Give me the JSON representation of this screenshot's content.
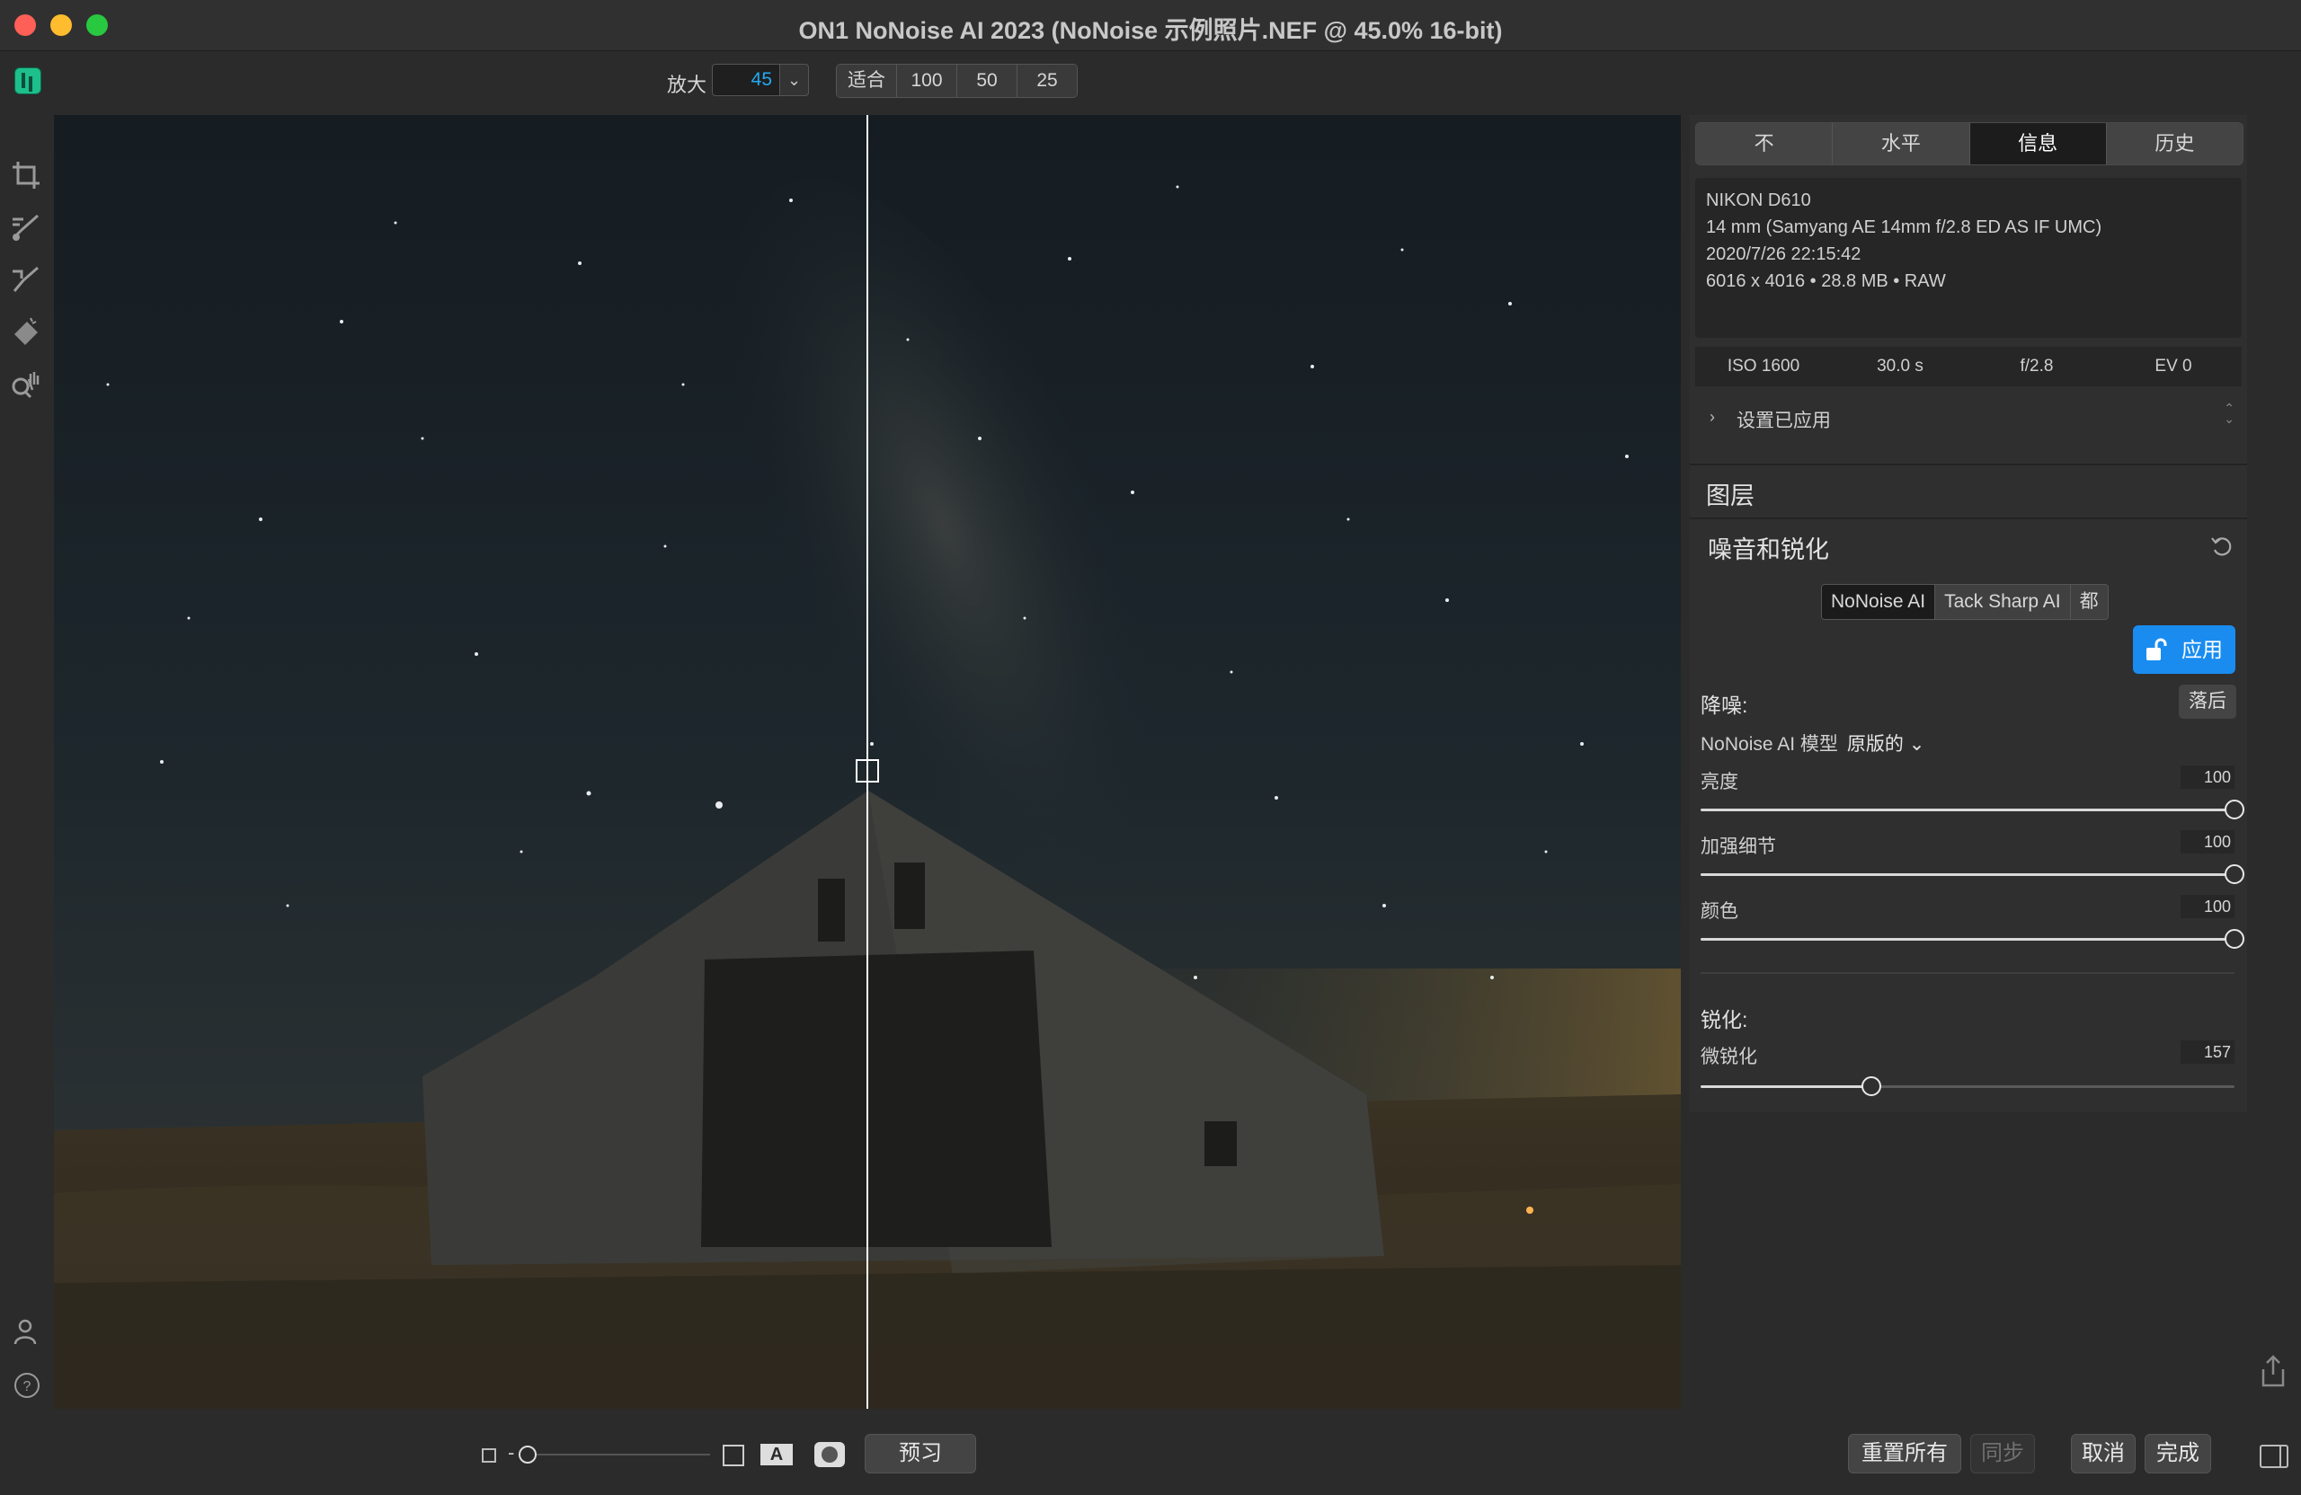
{
  "window": {
    "title": "ON1 NoNoise AI 2023 (NoNoise 示例照片.NEF @ 45.0% 16-bit)"
  },
  "toolbar": {
    "zoom_label": "放大",
    "zoom_value": "45",
    "zoom_presets": [
      "适合",
      "100",
      "50",
      "25"
    ]
  },
  "left_tools": [
    "crop-icon",
    "brush-icon",
    "retouch-brush-icon",
    "eraser-icon",
    "zoom-pan-icon"
  ],
  "panel": {
    "tabs": [
      {
        "label": "不",
        "active": false
      },
      {
        "label": "水平",
        "active": false
      },
      {
        "label": "信息",
        "active": true
      },
      {
        "label": "历史",
        "active": false
      }
    ],
    "info": {
      "camera": "NIKON D610",
      "lens": "14 mm (Samyang AE 14mm f/2.8 ED AS IF UMC)",
      "datetime": "2020/7/26  22:15:42",
      "size": "6016 x 4016 • 28.8 MB • RAW"
    },
    "exif": [
      "ISO 1600",
      "30.0 s",
      "f/2.8",
      "EV 0"
    ],
    "settings_applied": "设置已应用",
    "layers_title": "图层",
    "noise_title": "噪音和锐化",
    "modes": [
      {
        "label": "NoNoise AI",
        "active": true
      },
      {
        "label": "Tack Sharp AI",
        "active": false
      },
      {
        "label": "都",
        "active": false
      }
    ],
    "apply_label": "应用",
    "denoise_label": "降噪:",
    "behind_label": "落后",
    "model_label": "NoNoise AI 模型",
    "model_value": "原版的",
    "sliders": [
      {
        "label": "亮度",
        "value": "100",
        "fraction": 1.0
      },
      {
        "label": "加强细节",
        "value": "100",
        "fraction": 1.0
      },
      {
        "label": "颜色",
        "value": "100",
        "fraction": 1.0
      }
    ],
    "sharpen_label": "锐化:",
    "sharpen_slider": {
      "label": "微锐化",
      "value": "157",
      "fraction": 0.32
    }
  },
  "bottom": {
    "preview_label": "预习",
    "reset_all_label": "重置所有",
    "sync_label": "同步",
    "cancel_label": "取消",
    "done_label": "完成"
  },
  "colors": {
    "accent": "#1a8cf0",
    "zoom_text": "#23a9f2",
    "close": "#fe5f57",
    "minimize": "#febc2e",
    "maximize": "#28c840"
  }
}
